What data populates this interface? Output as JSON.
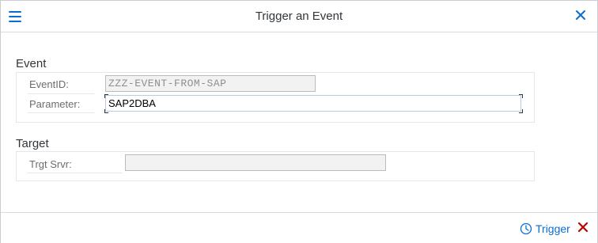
{
  "dialog": {
    "title": "Trigger an Event",
    "menu_icon": "hamburger-menu-icon",
    "close_icon": "close-icon"
  },
  "event_section": {
    "title": "Event",
    "fields": [
      {
        "label": "EventID:",
        "value": "ZZZ-EVENT-FROM-SAP",
        "editable": false
      },
      {
        "label": "Parameter:",
        "value": "SAP2DBA",
        "editable": true
      }
    ]
  },
  "target_section": {
    "title": "Target",
    "fields": [
      {
        "label": "Trgt Srvr:",
        "value": "",
        "editable": false
      }
    ]
  },
  "footer": {
    "trigger_label": "Trigger",
    "trigger_icon": "clock-icon",
    "cancel_icon": "cancel-x-icon"
  },
  "colors": {
    "accent": "#0a6ed1",
    "cancel": "#bb0000",
    "text": "#32363a",
    "label": "#6a6d70"
  }
}
